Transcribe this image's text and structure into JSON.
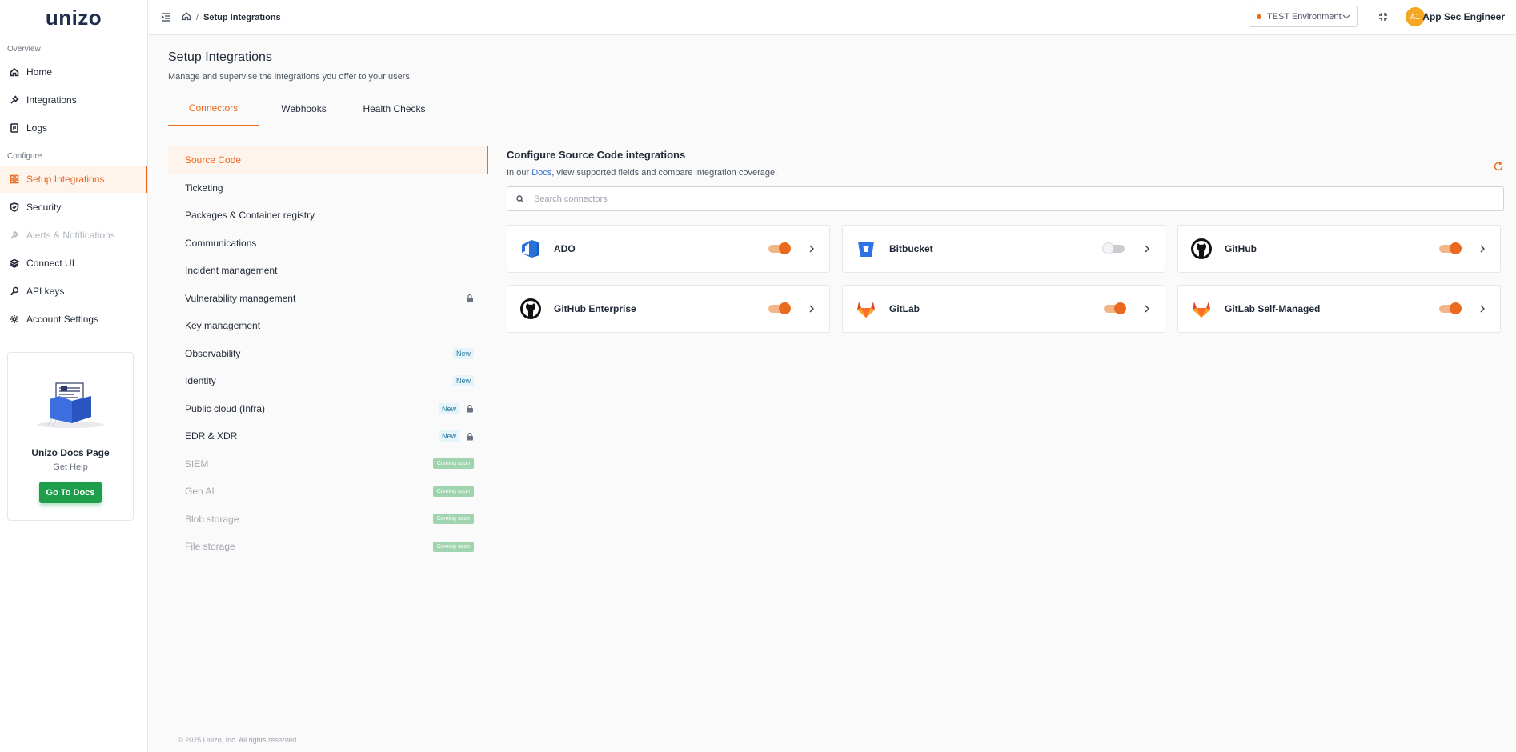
{
  "brand": {
    "name": "unizo",
    "accent": "#ea6a1f",
    "success": "#1e9e4a"
  },
  "sidebar": {
    "overview_label": "Overview",
    "configure_label": "Configure",
    "overview_items": [
      {
        "label": "Home",
        "icon": "home-icon"
      },
      {
        "label": "Integrations",
        "icon": "plug-icon"
      },
      {
        "label": "Logs",
        "icon": "log-icon"
      }
    ],
    "configure_items": [
      {
        "label": "Setup Integrations",
        "icon": "grid-icon",
        "active": true
      },
      {
        "label": "Security",
        "icon": "shield-icon"
      },
      {
        "label": "Alerts & Notifications",
        "icon": "bell-icon",
        "disabled": true
      },
      {
        "label": "Connect UI",
        "icon": "layers-icon"
      },
      {
        "label": "API keys",
        "icon": "key-icon"
      },
      {
        "label": "Account Settings",
        "icon": "gear-icon"
      }
    ],
    "docs_card": {
      "title": "Unizo Docs Page",
      "subtitle": "Get Help",
      "button": "Go To Docs"
    }
  },
  "header": {
    "breadcrumb_current": "Setup Integrations",
    "breadcrumb_sep": "/",
    "environment": "TEST Environment",
    "user_initials": "A1",
    "user_name": "App Sec Engineer"
  },
  "main": {
    "title": "Setup Integrations",
    "subtitle": "Manage and supervise the integrations you offer to your users.",
    "tabs": [
      {
        "label": "Connectors",
        "active": true
      },
      {
        "label": "Webhooks"
      },
      {
        "label": "Health Checks"
      }
    ],
    "categories": [
      {
        "label": "Source Code",
        "active": true
      },
      {
        "label": "Ticketing"
      },
      {
        "label": "Packages & Container registry"
      },
      {
        "label": "Communications"
      },
      {
        "label": "Incident management"
      },
      {
        "label": "Vulnerability management",
        "locked": true
      },
      {
        "label": "Key management"
      },
      {
        "label": "Observability",
        "badge": "New"
      },
      {
        "label": "Identity",
        "badge": "New"
      },
      {
        "label": "Public cloud (Infra)",
        "badge": "New",
        "locked": true
      },
      {
        "label": "EDR & XDR",
        "badge": "New",
        "locked": true
      },
      {
        "label": "SIEM",
        "soon": "Coming soon",
        "disabled": true
      },
      {
        "label": "Gen AI",
        "soon": "Coming soon",
        "disabled": true
      },
      {
        "label": "Blob storage",
        "soon": "Coming soon",
        "disabled": true
      },
      {
        "label": "File storage",
        "soon": "Coming soon",
        "disabled": true
      }
    ],
    "panel": {
      "title": "Configure Source Code integrations",
      "desc_prefix": "In our ",
      "desc_link": "Docs",
      "desc_suffix": ", view supported fields and compare integration coverage.",
      "search_placeholder": "Search connectors"
    },
    "connectors": [
      {
        "name": "ADO",
        "logo": "azure-devops-logo",
        "enabled": true
      },
      {
        "name": "Bitbucket",
        "logo": "bitbucket-logo",
        "enabled": false
      },
      {
        "name": "GitHub",
        "logo": "github-logo",
        "enabled": true
      },
      {
        "name": "GitHub Enterprise",
        "logo": "github-logo",
        "enabled": true
      },
      {
        "name": "GitLab",
        "logo": "gitlab-logo",
        "enabled": true
      },
      {
        "name": "GitLab Self-Managed",
        "logo": "gitlab-logo",
        "enabled": true
      }
    ]
  },
  "footer": "© 2025 Unizo, Inc. All rights reserved."
}
